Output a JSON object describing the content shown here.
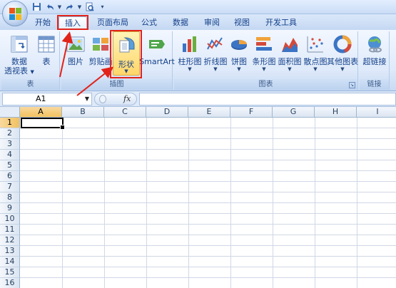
{
  "ribbon_tabs": [
    "开始",
    "插入",
    "页面布局",
    "公式",
    "数据",
    "审阅",
    "视图",
    "开发工具"
  ],
  "active_tab": "插入",
  "groups": {
    "table": {
      "label": "表",
      "pivot_label_line1": "数据",
      "pivot_label_line2": "透视表",
      "table_label": "表"
    },
    "illustrations": {
      "label": "插图",
      "picture_label": "图片",
      "clipart_label": "剪贴画",
      "shapes_label": "形状",
      "smartart_label": "SmartArt"
    },
    "charts": {
      "label": "图表",
      "column_label": "柱形图",
      "line_label": "折线图",
      "pie_label": "饼图",
      "bar_label": "条形图",
      "area_label": "面积图",
      "scatter_label": "散点图",
      "other_label": "其他图表"
    },
    "links": {
      "label": "链接",
      "hyperlink_label": "超链接"
    }
  },
  "formula_bar": {
    "name_box": "A1",
    "fx_label": "fx",
    "content": ""
  },
  "columns": [
    "A",
    "B",
    "C",
    "D",
    "E",
    "F",
    "G",
    "H",
    "I"
  ],
  "rows": [
    "1",
    "2",
    "3",
    "4",
    "5",
    "6",
    "7",
    "8",
    "9",
    "10",
    "11",
    "12",
    "13",
    "14",
    "15",
    "16"
  ],
  "selected_cell": "A1",
  "colors": {
    "highlight_red": "#e2231a",
    "selection_orange": "#f1c15f",
    "ribbon_blue": "#dfeafa"
  }
}
